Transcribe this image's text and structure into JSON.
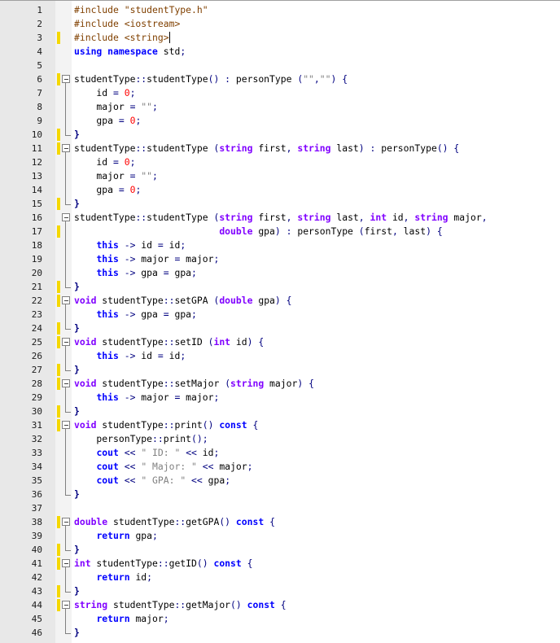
{
  "editor": {
    "lines": [
      {
        "n": "1",
        "mark": false,
        "fold": "none",
        "tokens": [
          [
            "pp",
            "#include "
          ],
          [
            "pp",
            "\"studentType.h\""
          ]
        ]
      },
      {
        "n": "2",
        "mark": false,
        "fold": "none",
        "tokens": [
          [
            "pp",
            "#include <iostream>"
          ]
        ]
      },
      {
        "n": "3",
        "mark": true,
        "fold": "none",
        "caret": true,
        "tokens": [
          [
            "pp",
            "#include <string>"
          ]
        ]
      },
      {
        "n": "4",
        "mark": false,
        "fold": "none",
        "tokens": [
          [
            "kw",
            "using namespace "
          ],
          [
            "plain",
            "std;"
          ]
        ]
      },
      {
        "n": "5",
        "mark": false,
        "fold": "none",
        "tokens": []
      },
      {
        "n": "6",
        "mark": true,
        "fold": "start",
        "tokens": [
          [
            "plain",
            "studentType::studentType() : personType (\"\",\"\") {"
          ]
        ]
      },
      {
        "n": "7",
        "mark": false,
        "fold": "mid",
        "tokens": [
          [
            "plain",
            "    id = 0;"
          ]
        ]
      },
      {
        "n": "8",
        "mark": false,
        "fold": "mid",
        "tokens": [
          [
            "plain",
            "    major = \"\";"
          ]
        ]
      },
      {
        "n": "9",
        "mark": false,
        "fold": "mid",
        "tokens": [
          [
            "plain",
            "    gpa = 0;"
          ]
        ]
      },
      {
        "n": "10",
        "mark": true,
        "fold": "end",
        "tokens": [
          [
            "op",
            "}"
          ]
        ]
      },
      {
        "n": "11",
        "mark": true,
        "fold": "start",
        "tokens": [
          [
            "plain",
            "studentType::studentType ("
          ],
          [
            "ty",
            "string"
          ],
          [
            "plain",
            " first, "
          ],
          [
            "ty",
            "string"
          ],
          [
            "plain",
            " last) : personType() {"
          ]
        ]
      },
      {
        "n": "12",
        "mark": false,
        "fold": "mid",
        "tokens": [
          [
            "plain",
            "    id = 0;"
          ]
        ]
      },
      {
        "n": "13",
        "mark": false,
        "fold": "mid",
        "tokens": [
          [
            "plain",
            "    major = \"\";"
          ]
        ]
      },
      {
        "n": "14",
        "mark": false,
        "fold": "mid",
        "tokens": [
          [
            "plain",
            "    gpa = 0;"
          ]
        ]
      },
      {
        "n": "15",
        "mark": true,
        "fold": "end",
        "tokens": [
          [
            "op",
            "}"
          ]
        ]
      },
      {
        "n": "16",
        "mark": false,
        "fold": "start",
        "tokens": [
          [
            "plain",
            "studentType::studentType ("
          ],
          [
            "ty",
            "string"
          ],
          [
            "plain",
            " first, "
          ],
          [
            "ty",
            "string"
          ],
          [
            "plain",
            " last, "
          ],
          [
            "ty",
            "int"
          ],
          [
            "plain",
            " id, "
          ],
          [
            "ty",
            "string"
          ],
          [
            "plain",
            " major,"
          ]
        ]
      },
      {
        "n": "17",
        "mark": true,
        "fold": "mid",
        "tokens": [
          [
            "plain",
            "                          "
          ],
          [
            "ty",
            "double"
          ],
          [
            "plain",
            " gpa) : personType (first, last) {"
          ]
        ]
      },
      {
        "n": "18",
        "mark": false,
        "fold": "mid",
        "tokens": [
          [
            "plain",
            "    "
          ],
          [
            "kw",
            "this"
          ],
          [
            "plain",
            " -> id = id;"
          ]
        ]
      },
      {
        "n": "19",
        "mark": false,
        "fold": "mid",
        "tokens": [
          [
            "plain",
            "    "
          ],
          [
            "kw",
            "this"
          ],
          [
            "plain",
            " -> major = major;"
          ]
        ]
      },
      {
        "n": "20",
        "mark": false,
        "fold": "mid",
        "tokens": [
          [
            "plain",
            "    "
          ],
          [
            "kw",
            "this"
          ],
          [
            "plain",
            " -> gpa = gpa;"
          ]
        ]
      },
      {
        "n": "21",
        "mark": true,
        "fold": "end",
        "tokens": [
          [
            "op",
            "}"
          ]
        ]
      },
      {
        "n": "22",
        "mark": true,
        "fold": "start",
        "tokens": [
          [
            "ty",
            "void"
          ],
          [
            "plain",
            " studentType::setGPA ("
          ],
          [
            "ty",
            "double"
          ],
          [
            "plain",
            " gpa) {"
          ]
        ]
      },
      {
        "n": "23",
        "mark": false,
        "fold": "mid",
        "tokens": [
          [
            "plain",
            "    "
          ],
          [
            "kw",
            "this"
          ],
          [
            "plain",
            " -> gpa = gpa;"
          ]
        ]
      },
      {
        "n": "24",
        "mark": true,
        "fold": "end",
        "tokens": [
          [
            "op",
            "}"
          ]
        ]
      },
      {
        "n": "25",
        "mark": true,
        "fold": "start",
        "tokens": [
          [
            "ty",
            "void"
          ],
          [
            "plain",
            " studentType::setID ("
          ],
          [
            "ty",
            "int"
          ],
          [
            "plain",
            " id) {"
          ]
        ]
      },
      {
        "n": "26",
        "mark": false,
        "fold": "mid",
        "tokens": [
          [
            "plain",
            "    "
          ],
          [
            "kw",
            "this"
          ],
          [
            "plain",
            " -> id = id;"
          ]
        ]
      },
      {
        "n": "27",
        "mark": true,
        "fold": "end",
        "tokens": [
          [
            "op",
            "}"
          ]
        ]
      },
      {
        "n": "28",
        "mark": true,
        "fold": "start",
        "tokens": [
          [
            "ty",
            "void"
          ],
          [
            "plain",
            " studentType::setMajor ("
          ],
          [
            "ty",
            "string"
          ],
          [
            "plain",
            " major) {"
          ]
        ]
      },
      {
        "n": "29",
        "mark": false,
        "fold": "mid",
        "tokens": [
          [
            "plain",
            "    "
          ],
          [
            "kw",
            "this"
          ],
          [
            "plain",
            " -> major = major;"
          ]
        ]
      },
      {
        "n": "30",
        "mark": true,
        "fold": "end",
        "tokens": [
          [
            "op",
            "}"
          ]
        ]
      },
      {
        "n": "31",
        "mark": true,
        "fold": "start",
        "tokens": [
          [
            "ty",
            "void"
          ],
          [
            "plain",
            " studentType::print() "
          ],
          [
            "kw",
            "const"
          ],
          [
            "plain",
            " {"
          ]
        ]
      },
      {
        "n": "32",
        "mark": false,
        "fold": "mid",
        "tokens": [
          [
            "plain",
            "    personType::print();"
          ]
        ]
      },
      {
        "n": "33",
        "mark": false,
        "fold": "mid",
        "tokens": [
          [
            "plain",
            "    "
          ],
          [
            "lib",
            "cout"
          ],
          [
            "plain",
            " << "
          ],
          [
            "str",
            "\" ID: \""
          ],
          [
            "plain",
            " << id;"
          ]
        ]
      },
      {
        "n": "34",
        "mark": false,
        "fold": "mid",
        "tokens": [
          [
            "plain",
            "    "
          ],
          [
            "lib",
            "cout"
          ],
          [
            "plain",
            " << "
          ],
          [
            "str",
            "\" Major: \""
          ],
          [
            "plain",
            " << major;"
          ]
        ]
      },
      {
        "n": "35",
        "mark": false,
        "fold": "mid",
        "tokens": [
          [
            "plain",
            "    "
          ],
          [
            "lib",
            "cout"
          ],
          [
            "plain",
            " << "
          ],
          [
            "str",
            "\" GPA: \""
          ],
          [
            "plain",
            " << gpa;"
          ]
        ]
      },
      {
        "n": "36",
        "mark": false,
        "fold": "end",
        "tokens": [
          [
            "op",
            "}"
          ]
        ]
      },
      {
        "n": "37",
        "mark": false,
        "fold": "none",
        "tokens": []
      },
      {
        "n": "38",
        "mark": true,
        "fold": "start",
        "tokens": [
          [
            "ty",
            "double"
          ],
          [
            "plain",
            " studentType::getGPA() "
          ],
          [
            "kw",
            "const"
          ],
          [
            "plain",
            " {"
          ]
        ]
      },
      {
        "n": "39",
        "mark": false,
        "fold": "mid",
        "tokens": [
          [
            "plain",
            "    "
          ],
          [
            "kw",
            "return"
          ],
          [
            "plain",
            " gpa;"
          ]
        ]
      },
      {
        "n": "40",
        "mark": true,
        "fold": "end",
        "tokens": [
          [
            "op",
            "}"
          ]
        ]
      },
      {
        "n": "41",
        "mark": true,
        "fold": "start",
        "tokens": [
          [
            "ty",
            "int"
          ],
          [
            "plain",
            " studentType::getID() "
          ],
          [
            "kw",
            "const"
          ],
          [
            "plain",
            " {"
          ]
        ]
      },
      {
        "n": "42",
        "mark": false,
        "fold": "mid",
        "tokens": [
          [
            "plain",
            "    "
          ],
          [
            "kw",
            "return"
          ],
          [
            "plain",
            " id;"
          ]
        ]
      },
      {
        "n": "43",
        "mark": true,
        "fold": "end",
        "tokens": [
          [
            "op",
            "}"
          ]
        ]
      },
      {
        "n": "44",
        "mark": true,
        "fold": "start",
        "tokens": [
          [
            "ty",
            "string"
          ],
          [
            "plain",
            " studentType::getMajor() "
          ],
          [
            "kw",
            "const"
          ],
          [
            "plain",
            " {"
          ]
        ]
      },
      {
        "n": "45",
        "mark": false,
        "fold": "mid",
        "tokens": [
          [
            "plain",
            "    "
          ],
          [
            "kw",
            "return"
          ],
          [
            "plain",
            " major;"
          ]
        ]
      },
      {
        "n": "46",
        "mark": false,
        "fold": "end",
        "tokens": [
          [
            "op",
            "}"
          ]
        ]
      }
    ]
  },
  "colors": {
    "change_marker": "#f5d800",
    "preprocessor": "#804000",
    "keyword": "#0000ff",
    "type": "#8000ff",
    "string": "#808080",
    "number": "#ff0000",
    "brace": "#000080"
  }
}
